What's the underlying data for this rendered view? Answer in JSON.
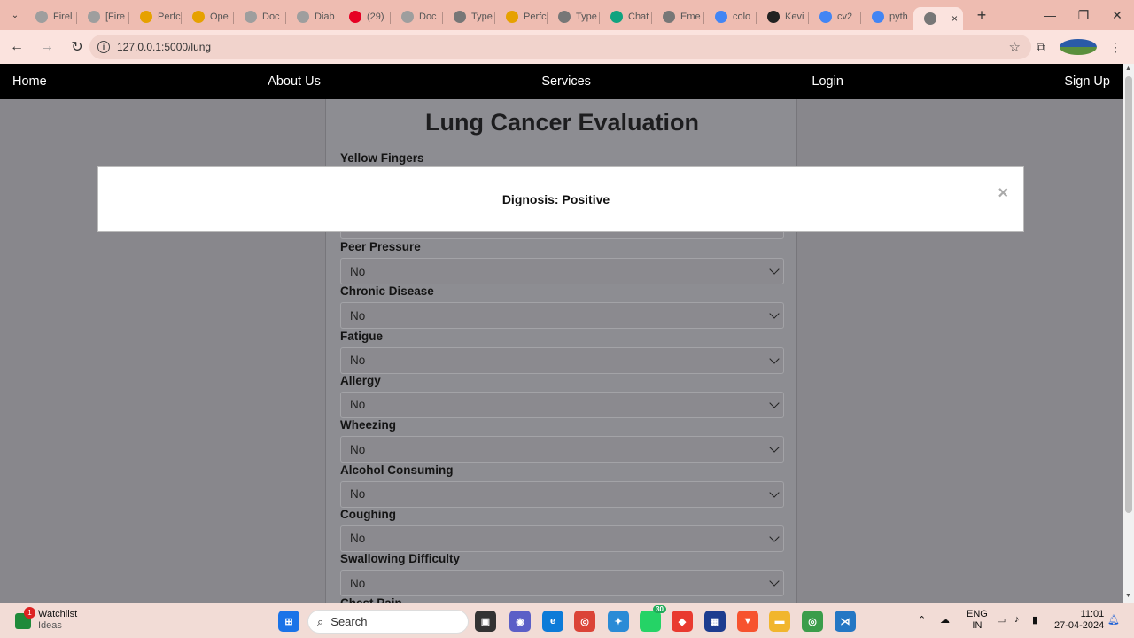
{
  "browser": {
    "tabs": [
      {
        "label": "Firel",
        "color": "#9e9e9e"
      },
      {
        "label": "[Fire",
        "color": "#9e9e9e"
      },
      {
        "label": "Perfc",
        "color": "#e6a100"
      },
      {
        "label": "Ope",
        "color": "#e6a100"
      },
      {
        "label": "Doc",
        "color": "#9e9e9e"
      },
      {
        "label": "Diab",
        "color": "#9e9e9e"
      },
      {
        "label": "(29)",
        "color": "#e60023"
      },
      {
        "label": "Doc",
        "color": "#9e9e9e"
      },
      {
        "label": "Type",
        "color": "#777777"
      },
      {
        "label": "Perfc",
        "color": "#e6a100"
      },
      {
        "label": "Type",
        "color": "#777777"
      },
      {
        "label": "Chat",
        "color": "#10a37f"
      },
      {
        "label": "Eme",
        "color": "#777777"
      },
      {
        "label": "colo",
        "color": "#4285f4"
      },
      {
        "label": "Kevi",
        "color": "#222222"
      },
      {
        "label": "cv2",
        "color": "#4285f4"
      },
      {
        "label": "pyth",
        "color": "#4285f4"
      }
    ],
    "active_tab_close": "×",
    "url": "127.0.0.1:5000/lung"
  },
  "nav": {
    "home": "Home",
    "about": "About Us",
    "services": "Services",
    "login": "Login",
    "signup": "Sign Up"
  },
  "form": {
    "title": "Lung Cancer Evaluation",
    "first_label": "Yellow Fingers",
    "fields": [
      {
        "label": "Peer Pressure",
        "value": "No"
      },
      {
        "label": "Chronic Disease",
        "value": "No"
      },
      {
        "label": "Fatigue",
        "value": "No"
      },
      {
        "label": "Allergy",
        "value": "No"
      },
      {
        "label": "Wheezing",
        "value": "No"
      },
      {
        "label": "Alcohol Consuming",
        "value": "No"
      },
      {
        "label": "Coughing",
        "value": "No"
      },
      {
        "label": "Swallowing Difficulty",
        "value": "No"
      },
      {
        "label": "Chest Pain",
        "value": ""
      }
    ]
  },
  "modal": {
    "text": "Dignosis: Positive",
    "close": "×"
  },
  "taskbar": {
    "widget_title": "Watchlist",
    "widget_sub": "Ideas",
    "widget_badge": "1",
    "search_placeholder": "Search",
    "whatsapp_badge": "30",
    "lang": "ENG",
    "region": "IN",
    "time": "11:01",
    "date": "27-04-2024"
  }
}
